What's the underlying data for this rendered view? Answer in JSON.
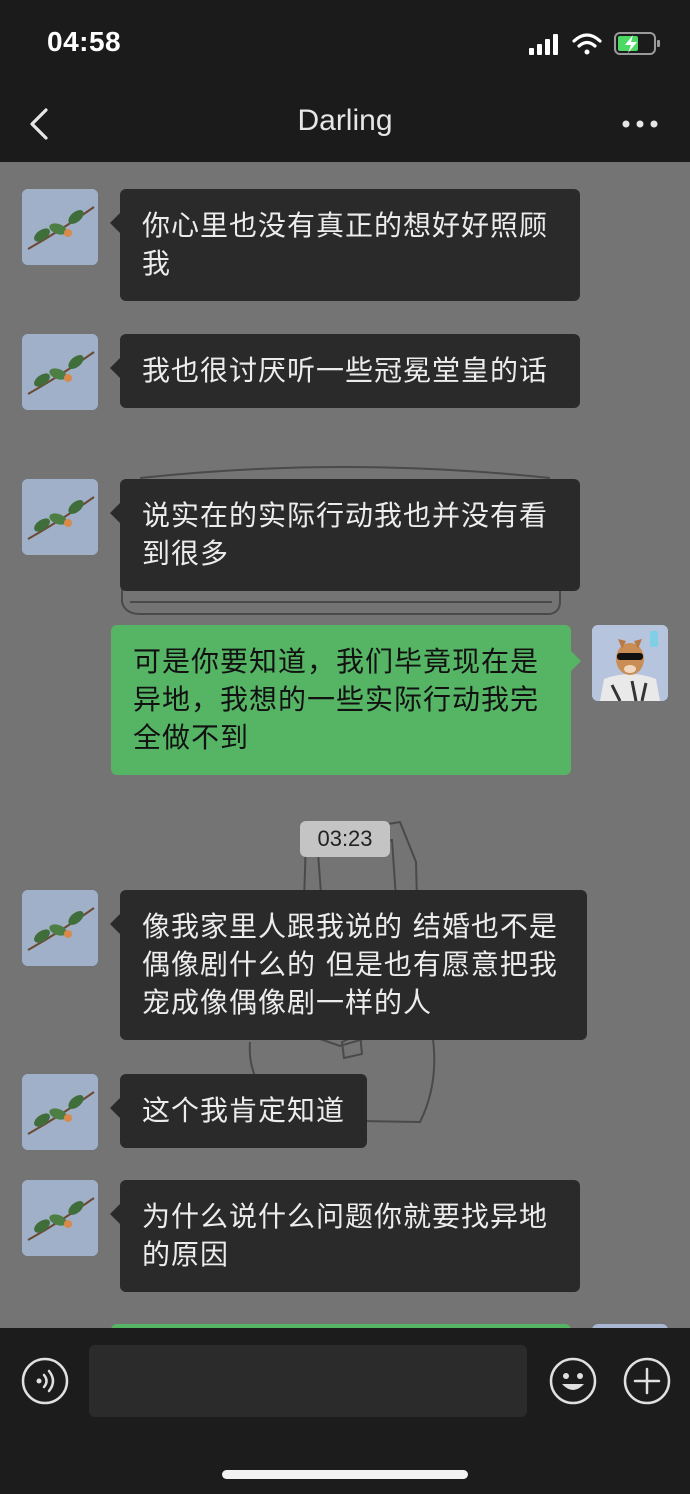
{
  "status_bar": {
    "time": "04:58"
  },
  "header": {
    "title": "Darling"
  },
  "messages": [
    {
      "side": "other",
      "text": "你心里也没有真正的想好好照顾我"
    },
    {
      "side": "other",
      "text": "我也很讨厌听一些冠冕堂皇的话"
    },
    {
      "side": "other",
      "text": "说实在的实际行动我也并没有看到很多"
    },
    {
      "side": "mine",
      "text": "可是你要知道，我们毕竟现在是异地，我想的一些实际行动我完全做不到"
    },
    {
      "side": "other",
      "text": "像我家里人跟我说的 结婚也不是偶像剧什么的 但是也有愿意把我宠成像偶像剧一样的人"
    },
    {
      "side": "other",
      "text": "这个我肯定知道"
    },
    {
      "side": "other",
      "text": "为什么说什么问题你就要找异地的原因"
    }
  ],
  "timestamp": "03:23",
  "input": {
    "placeholder": ""
  },
  "colors": {
    "chat_background": "#747474",
    "bar_background": "#1b1b1b",
    "incoming_bubble": "#2a2a2a",
    "outgoing_bubble": "#55b565",
    "timestamp_pill": "#c4c4c4"
  }
}
